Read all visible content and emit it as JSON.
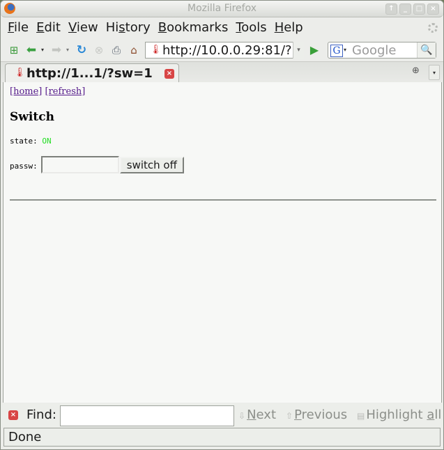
{
  "window": {
    "title": "Mozilla Firefox",
    "buttons": [
      "up-icon",
      "minimize-icon",
      "maximize-icon",
      "close-icon"
    ]
  },
  "menubar": {
    "items": [
      {
        "label": "File",
        "accel": "F",
        "rest": "ile"
      },
      {
        "label": "Edit",
        "accel": "E",
        "rest": "dit"
      },
      {
        "label": "View",
        "accel": "V",
        "rest": "iew"
      },
      {
        "label": "History",
        "pre": "Hi",
        "accel": "s",
        "rest": "tory"
      },
      {
        "label": "Bookmarks",
        "accel": "B",
        "rest": "ookmarks"
      },
      {
        "label": "Tools",
        "accel": "T",
        "rest": "ools"
      },
      {
        "label": "Help",
        "accel": "H",
        "rest": "elp"
      }
    ]
  },
  "navbar": {
    "url": "http://10.0.0.29:81/?",
    "search_placeholder": "Google",
    "search_engine": "G"
  },
  "tabs": [
    {
      "label": "http://1...1/?sw=1",
      "active": true
    }
  ],
  "page": {
    "links": [
      "[home]",
      "[refresh]"
    ],
    "heading": "Switch",
    "state_label": "state:",
    "state_value": "ON",
    "state_color": "#22dd22",
    "passw_label": "passw:",
    "passw_value": "",
    "submit_label": "switch off"
  },
  "findbar": {
    "label": "Find:",
    "value": "",
    "next": {
      "accel": "N",
      "rest": "ext"
    },
    "previous": {
      "accel": "P",
      "rest": "revious"
    },
    "highlight": {
      "pre": "Highlight ",
      "accel": "a",
      "rest": "ll"
    }
  },
  "status": {
    "text": "Done"
  }
}
